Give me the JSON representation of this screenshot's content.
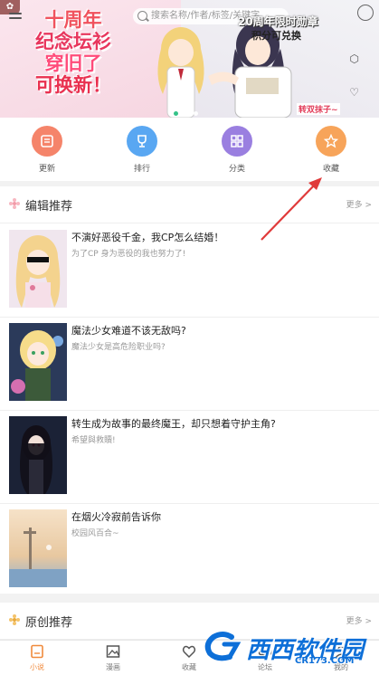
{
  "header": {
    "search_placeholder": "搜索名称/作者/标签/关键字"
  },
  "banner": {
    "promo_lines": [
      "十周年",
      "纪念坛衫",
      "穿旧了",
      "可换新！"
    ],
    "event_title": "20周年限时勋章",
    "event_sub": "积分可兑换",
    "tag": "转双抹子~",
    "active_dot": 0,
    "dot_count": 3
  },
  "categories": [
    {
      "label": "更新",
      "icon": "book-icon",
      "color": "#f5846a"
    },
    {
      "label": "排行",
      "icon": "trophy-icon",
      "color": "#59a7f2"
    },
    {
      "label": "分类",
      "icon": "grid-icon",
      "color": "#9a7fe0"
    },
    {
      "label": "收藏",
      "icon": "star-icon",
      "color": "#f7a45a"
    }
  ],
  "editor_section": {
    "title": "编辑推荐",
    "more": "更多 >",
    "items": [
      {
        "title": "不演好恶役千金，我CP怎么结婚！",
        "desc": "为了CP 身为恶役的我也努力了!"
      },
      {
        "title": "魔法少女难道不该无敌吗?",
        "desc": "魔法少女是高危险职业吗?"
      },
      {
        "title": "转生成为故事的最终魔王，却只想着守护主角?",
        "desc": "希望與救贖!"
      },
      {
        "title": "在烟火冷寂前告诉你",
        "desc": "校园风百合~"
      }
    ]
  },
  "original_section": {
    "title": "原创推荐",
    "more": "更多 >"
  },
  "bottom_nav": [
    {
      "label": "小说",
      "icon": "book-tab-icon",
      "active": true
    },
    {
      "label": "漫画",
      "icon": "image-tab-icon",
      "active": false
    },
    {
      "label": "收藏",
      "icon": "heart-tab-icon",
      "active": false
    },
    {
      "label": "论坛",
      "icon": "forum-tab-icon",
      "active": false
    },
    {
      "label": "我的",
      "icon": "profile-tab-icon",
      "active": false
    }
  ],
  "watermark": {
    "text": "西西软件园",
    "url": "CR173.COM"
  },
  "colors": {
    "accent": "#f08a3c",
    "dot_active": "#1fbb7b",
    "promo": "#e8365d",
    "annotation_arrow": "#e03a3a"
  }
}
